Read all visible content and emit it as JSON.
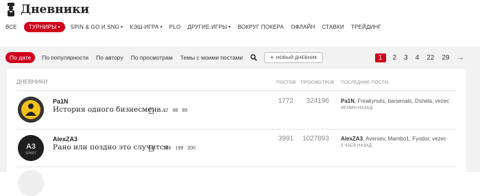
{
  "header": {
    "title": "Дневники",
    "logo_icon": "chef-figure-icon"
  },
  "nav": {
    "items": [
      {
        "label": "ВСЕ",
        "active": false,
        "dropdown": false
      },
      {
        "label": "ТУРНИРЫ",
        "active": true,
        "dropdown": true
      },
      {
        "label": "SPIN & GO И SNG",
        "active": false,
        "dropdown": true
      },
      {
        "label": "КЭШ-ИГРА",
        "active": false,
        "dropdown": true
      },
      {
        "label": "PLO",
        "active": false,
        "dropdown": false
      },
      {
        "label": "ДРУГИЕ ИГРЫ",
        "active": false,
        "dropdown": true
      },
      {
        "label": "ВОКРУГ ПОКЕРА",
        "active": false,
        "dropdown": false
      },
      {
        "label": "ОФЛАЙН",
        "active": false,
        "dropdown": false
      },
      {
        "label": "СТАВКИ",
        "active": false,
        "dropdown": false
      },
      {
        "label": "ТРЕЙДИНГ",
        "active": false,
        "dropdown": false
      }
    ]
  },
  "sort_tabs": {
    "items": [
      "По дате",
      "По популярности",
      "По автору",
      "По просмотрам",
      "Темы с моими постами"
    ],
    "active_index": 0,
    "new_diary_label": "НОВЫЙ ДНЕВНИК"
  },
  "pager": {
    "pages": [
      "1",
      "2",
      "3",
      "4",
      "22",
      "29"
    ],
    "active": "1",
    "next_arrow": "→"
  },
  "table": {
    "headers": {
      "diaries": "ДНЕВНИКИ",
      "posts": "ПОСТОВ",
      "views": "ПРОСМОТРОВ",
      "last_posts": "ПОСЛЕДНИЕ ПОСТЫ"
    },
    "rows": [
      {
        "author": "Pa1N",
        "title": "История одного бизнесмена...",
        "pages": [
          "1",
          "87",
          "88",
          "89"
        ],
        "posts": "1772",
        "views": "324196",
        "last_users_bold": "Pa1N",
        "last_users_rest": ", Freakynuts, barsenalo, Dshela, vezec",
        "ago": "49 МИН НАЗАД"
      },
      {
        "author": "AlexZA3",
        "title": "Рано или поздно это случится",
        "pages": [
          "1",
          "198",
          "199",
          "200"
        ],
        "posts": "3991",
        "views": "1027893",
        "last_users_bold": "AlexZA3",
        "last_users_rest": ", Aversev, Mambo1, Fyodor, vezec",
        "ago": "3 ЧАСА НАЗАД"
      }
    ]
  },
  "colors": {
    "accent": "#d0021b",
    "background": "#f2f2f2"
  }
}
